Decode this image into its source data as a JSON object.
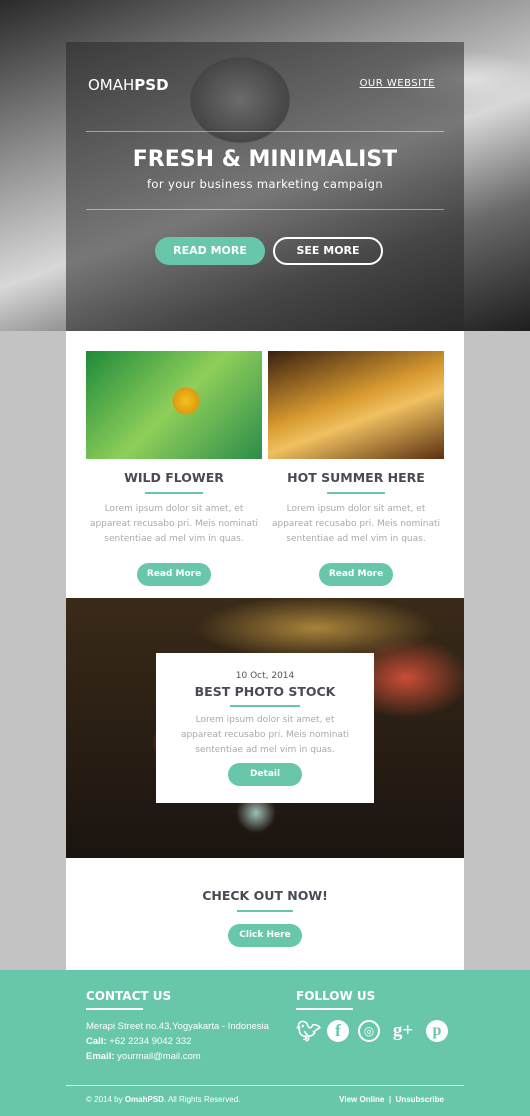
{
  "header": {
    "logo_light": "OMAH",
    "logo_bold": "PSD",
    "website_link": "OUR WEBSITE",
    "title": "FRESH & MINIMALIST",
    "subtitle": "for your business marketing campaign",
    "read_more": "READ MORE",
    "see_more": "SEE MORE"
  },
  "cards": [
    {
      "title": "WILD FLOWER",
      "text": "Lorem ipsum dolor sit amet, et appareat recusabo pri. Meis nominati sententiae ad mel vim in quas.",
      "button": "Read More"
    },
    {
      "title": "HOT SUMMER HERE",
      "text": "Lorem ipsum dolor sit amet, et appareat recusabo pri. Meis nominati sententiae ad mel vim in quas.",
      "button": "Read More"
    }
  ],
  "feature": {
    "date": "10 Oct, 2014",
    "title": "BEST PHOTO STOCK",
    "text": "Lorem ipsum dolor sit amet, et appareat recusabo pri. Meis nominati sententiae ad mel vim in quas.",
    "button": "Detail"
  },
  "cta": {
    "title": "CHECK OUT NOW!",
    "button": "Click Here"
  },
  "footer": {
    "contact_title": "CONTACT US",
    "address": "Merapi Street no.43,Yogyakarta - Indonesia",
    "call_label": "Call:",
    "call": "+62 2234 9042 332",
    "email_label": "Email:",
    "email": "yourmail@mail.com",
    "follow_title": "FOLLOW US",
    "social": [
      "twitter-icon",
      "facebook-icon",
      "dribbble-icon",
      "google-plus-icon",
      "pinterest-icon"
    ],
    "copyright_pre": "© 2014 by ",
    "copyright_brand": "OmahPSD",
    "copyright_post": ". All Rights Reserved.",
    "view_online": "View Online",
    "separator": "|",
    "unsubscribe": "Unsubscribe"
  },
  "colors": {
    "accent": "#68c7ab",
    "background": "#c3c3c3",
    "heading": "#4a4a55"
  }
}
